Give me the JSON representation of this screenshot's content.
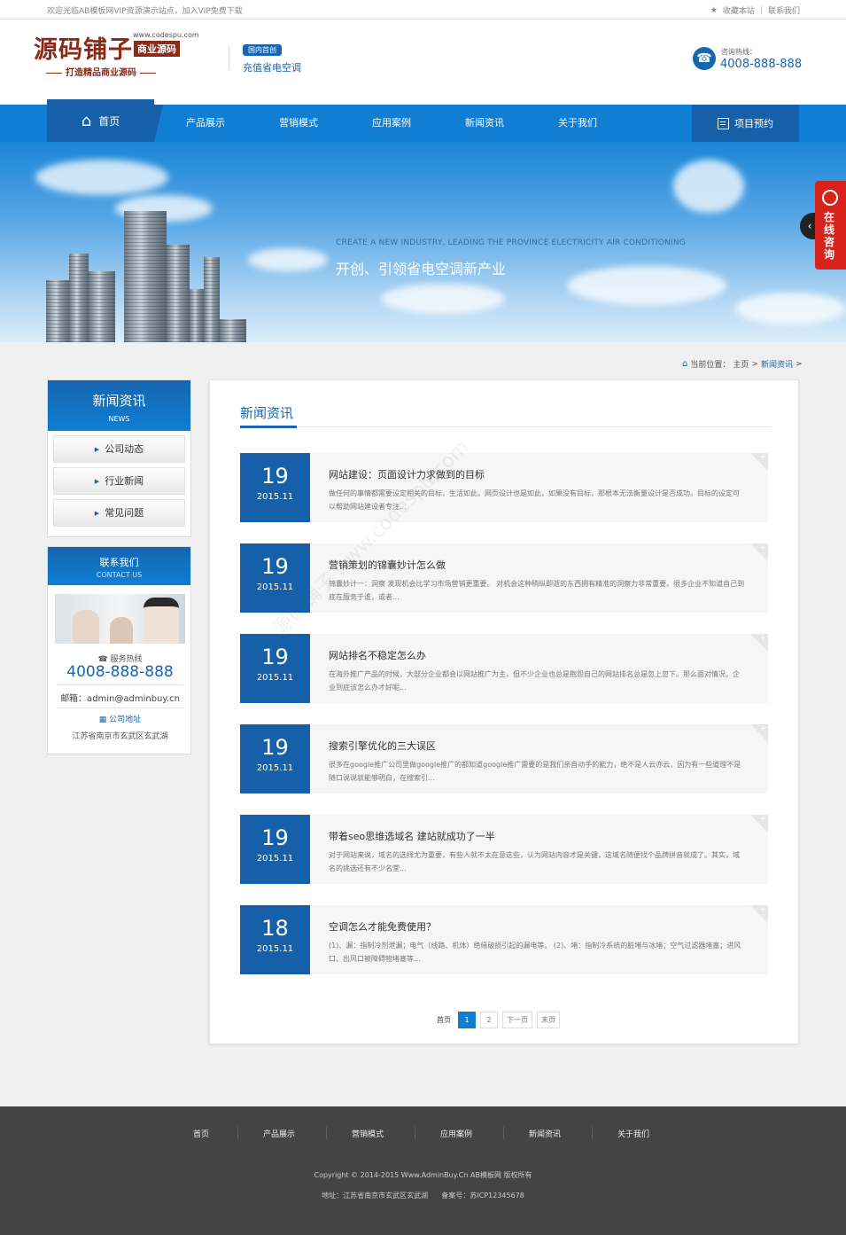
{
  "topbar": {
    "welcome": "欢迎光临AB模板网VIP资源演示站点，加入VIP免费下载",
    "favorite": "收藏本站",
    "contact": "联系我们"
  },
  "header": {
    "logo_main": "源码铺子",
    "logo_url": "www.codespu.com",
    "logo_tag": "商业源码",
    "logo_slogan": "打造精品商业源码",
    "badge": "国内首创",
    "subtitle": "充值省电空调",
    "hotline_label": "咨询热线：",
    "hotline": "4008-888-888"
  },
  "nav": {
    "home": "首页",
    "items": [
      "产品展示",
      "营销模式",
      "应用案例",
      "新闻资讯",
      "关于我们"
    ],
    "booking": "项目预约"
  },
  "banner": {
    "en": "CREATE A NEW INDUSTRY, LEADING THE PROVINCE ELECTRICITY AIR CONDITIONING",
    "cn": "开创、引领省电空调新产业",
    "float_tab": "在线咨询"
  },
  "breadcrumb": {
    "prefix": "当前位置：",
    "home": "主页",
    "current": "新闻资讯"
  },
  "sidebar": {
    "title": "新闻资讯",
    "subtitle": "NEWS",
    "items": [
      "公司动态",
      "行业新闻",
      "常见问题"
    ]
  },
  "contact": {
    "title": "联系我们",
    "subtitle": "CONTACT US",
    "service_label": "服务热线",
    "tel": "4008-888-888",
    "email": "邮箱：admin@adminbuy.cn",
    "address_label": "公司地址",
    "address": "江苏省南京市玄武区玄武湖"
  },
  "main": {
    "title": "新闻资讯",
    "news": [
      {
        "day": "19",
        "ym": "2015.11",
        "title": "网站建设：页面设计力求做到的目标",
        "desc": "做任何的事情都需要设定相关的目标，生活如此，网页设计也是如此，如果没有目标，那根本无法衡量设计是否成功。目标的设定可以帮助网站建设者专注..."
      },
      {
        "day": "19",
        "ym": "2015.11",
        "title": "营销策划的锦囊妙计怎么做",
        "desc": "锦囊妙计一：洞察 发现机会比学习市场营销更重要。 对机会这种稍纵即逝的东西拥有精准的洞察力非常重要。很多企业不知道自己到底在服务于谁，或者..."
      },
      {
        "day": "19",
        "ym": "2015.11",
        "title": "网站排名不稳定怎么办",
        "desc": "在海外推广产品的时候，大部分企业都会以网站推广为主，但不少企业也总是抱怨自己的网站排名总是忽上忽下。那么面对情况，企业到底该怎么办才好呢..."
      },
      {
        "day": "19",
        "ym": "2015.11",
        "title": "搜索引擎优化的三大误区",
        "desc": "很多在google推广公司里做google推广的都知道google推广需要的是我们亲自动手的能力，绝不是人云亦云，因为有一些道理不是随口说说就能够明白，在搜索引..."
      },
      {
        "day": "19",
        "ym": "2015.11",
        "title": "带着seo思维选域名 建站就成功了一半",
        "desc": "对于网站来说，域名的选择尤为重要，有些人就不太在意这些，认为网站内容才是关键，这域名随便找个品牌拼音就成了。其实，域名的挑选还有不少名堂..."
      },
      {
        "day": "18",
        "ym": "2015.11",
        "title": "空调怎么才能免费使用？",
        "desc": "(1)、漏：指制冷剂泄漏；电气（线路、机体）绝缘破损引起的漏电等。 (2)、堵：指制冷系统的脏堵与冰堵；空气过滤器堵塞；进风口、出风口被障碍物堵塞等..."
      }
    ],
    "pager": {
      "first": "首页",
      "pages": [
        "1",
        "2"
      ],
      "next": "下一页",
      "last": "末页"
    }
  },
  "footer": {
    "nav": [
      "首页",
      "产品展示",
      "营销模式",
      "应用案例",
      "新闻资讯",
      "关于我们"
    ],
    "copyright": "Copyright © 2014-2015 Www.AdminBuy.Cn AB模板网 版权所有",
    "address": "地址：江苏省南京市玄武区玄武湖",
    "icp": "备案号：苏ICP12345678"
  },
  "watermark": "源码铺子 www.codespu.com",
  "colors": {
    "primary": "#1666b0",
    "nav": "#0f7ed3",
    "accent_red": "#d8221c",
    "footer": "#444444"
  }
}
